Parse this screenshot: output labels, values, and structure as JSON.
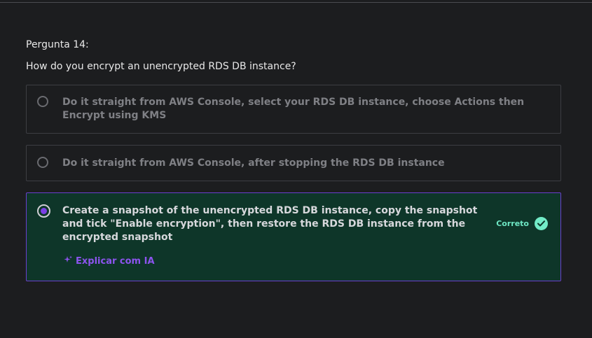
{
  "question": {
    "number_label": "Pergunta 14:",
    "text": "How do you encrypt an unencrypted RDS DB instance?"
  },
  "options": [
    {
      "text": "Do it straight from AWS Console, select your RDS DB instance, choose Actions then Encrypt using KMS",
      "selected": false
    },
    {
      "text": "Do it straight from AWS Console, after stopping the RDS DB instance",
      "selected": false
    },
    {
      "text": "Create a snapshot of the unencrypted RDS DB instance, copy the snapshot and tick \"Enable encryption\", then restore the RDS DB instance from the encrypted snapshot",
      "selected": true,
      "status_label": "Correto",
      "explain_label": "Explicar com IA"
    }
  ],
  "icons": {
    "sparkle": "sparkle-icon",
    "check": "check-circle-icon"
  },
  "colors": {
    "background": "#1c1d1f",
    "correct_bg": "#0e3629",
    "correct_border": "#6b3fcf",
    "accent_purple": "#8c54ee",
    "correct_green": "#72ebc7"
  }
}
